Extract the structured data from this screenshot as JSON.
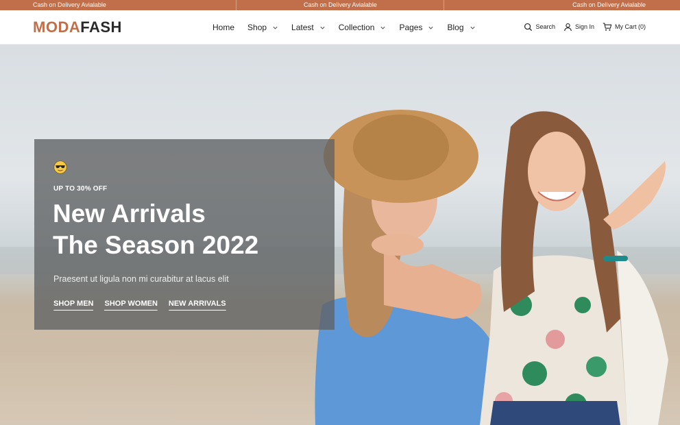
{
  "topbar": {
    "messages": [
      "Cash on Delivery Avialable",
      "Cash on Delivery Avialable",
      "Cash on Delivery Avialable"
    ],
    "bg_color": "#c06f4a"
  },
  "header": {
    "logo": {
      "part1": "MODA",
      "part2": "FASH",
      "accent_color": "#c06f4a"
    },
    "nav": [
      {
        "label": "Home",
        "has_dropdown": false
      },
      {
        "label": "Shop",
        "has_dropdown": true
      },
      {
        "label": "Latest",
        "has_dropdown": true
      },
      {
        "label": "Collection",
        "has_dropdown": true
      },
      {
        "label": "Pages",
        "has_dropdown": true
      },
      {
        "label": "Blog",
        "has_dropdown": true
      }
    ],
    "utility": {
      "search_label": "Search",
      "signin_label": "Sign In",
      "cart_label": "My Cart (0)",
      "search_icon": "search-icon",
      "signin_icon": "user-icon",
      "cart_icon": "cart-icon"
    }
  },
  "hero": {
    "emoji": "sunglasses-emoji",
    "eyebrow": "UP TO 30% OFF",
    "headline_line1": "New Arrivals",
    "headline_line2": "The Season 2022",
    "subtitle": "Praesent ut ligula non mi curabitur at lacus elit",
    "ctas": [
      "SHOP MEN",
      "SHOP WOMEN",
      "NEW ARRIVALS"
    ]
  }
}
